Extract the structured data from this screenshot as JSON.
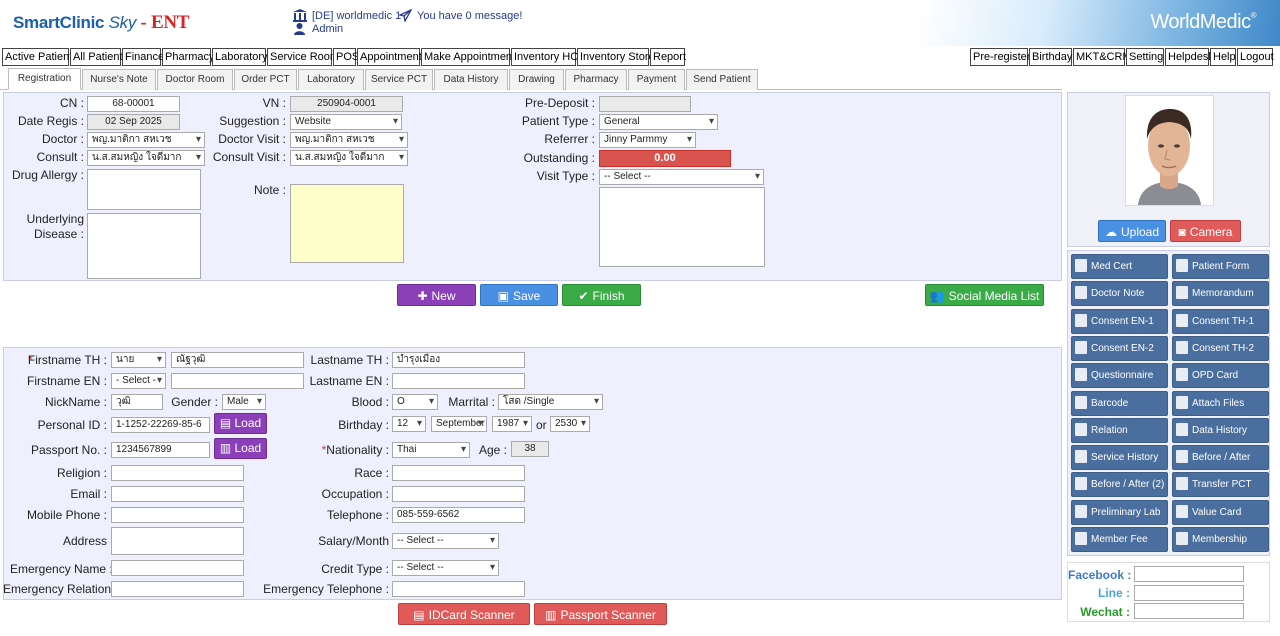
{
  "brand": {
    "name": "SmartClinic",
    "sky": "Sky",
    "dash": " - ",
    "ent": "ENT"
  },
  "header": {
    "branch": "[DE] worldmedic 1",
    "message": "You have 0 message!",
    "user": "Admin",
    "logo": "WorldMedic"
  },
  "menu_left": [
    "Active Patient",
    "All Patient",
    "Finance",
    "Pharmacy",
    "Laboratory",
    "Service Room",
    "POS",
    "Appointment",
    "Make Appointment",
    "Inventory HO",
    "Inventory Store",
    "Report"
  ],
  "menu_right": [
    "Pre-register",
    "Birthday",
    "MKT&CRM",
    "Setting",
    "Helpdesk",
    "Help",
    "Logout"
  ],
  "tabs": [
    "Registration",
    "Nurse's Note",
    "Doctor Room",
    "Order PCT",
    "Laboratory",
    "Service PCT",
    "Data History",
    "Drawing",
    "Pharmacy",
    "Payment",
    "Send Patient"
  ],
  "reg": {
    "cn_label": "CN :",
    "cn": "68-00001",
    "date_label": "Date Regis :",
    "date": "02 Sep 2025",
    "doctor_label": "Doctor :",
    "doctor": "พญ.มาติกา สหเวช",
    "consult_label": "Consult :",
    "consult": "น.ส.สมหญิง ใจดีมาก",
    "allergy_label": "Drug Allergy :",
    "underlying_label1": "Underlying",
    "underlying_label2": "Disease :",
    "vn_label": "VN :",
    "vn": "250904-0001",
    "suggestion_label": "Suggestion :",
    "suggestion": "Website",
    "dvisit_label": "Doctor Visit :",
    "dvisit": "พญ.มาติกา สหเวช",
    "cvisit_label": "Consult Visit :",
    "cvisit": "น.ส.สมหญิง ใจดีมาก",
    "note_label": "Note :",
    "predeposit_label": "Pre-Deposit :",
    "predeposit": "",
    "ptype_label": "Patient Type :",
    "ptype": "General",
    "referrer_label": "Referrer :",
    "referrer": "Jinny Parmmy",
    "outstanding_label": "Outstanding :",
    "outstanding": "0.00",
    "visittype_label": "Visit Type :",
    "visittype": "-- Select --"
  },
  "actions": {
    "new": "New",
    "save": "Save",
    "finish": "Finish",
    "social": "Social Media List"
  },
  "photo": {
    "upload": "Upload",
    "camera": "Camera"
  },
  "side_buttons": [
    [
      "Med Cert",
      "Patient Form"
    ],
    [
      "Doctor Note",
      "Memorandum"
    ],
    [
      "Consent EN-1",
      "Consent TH-1"
    ],
    [
      "Consent EN-2",
      "Consent TH-2"
    ],
    [
      "Questionnaire",
      "OPD Card"
    ],
    [
      "Barcode",
      "Attach Files"
    ],
    [
      "Relation",
      "Data History"
    ],
    [
      "Service History",
      "Before / After"
    ],
    [
      "Before / After (2)",
      "Transfer PCT"
    ],
    [
      "Preliminary Lab",
      "Value Card"
    ],
    [
      "Member Fee",
      "Membership"
    ]
  ],
  "social": {
    "facebook": "Facebook :",
    "line": "Line :",
    "wechat": "Wechat :",
    "colors": {
      "facebook": "#3b7ac9",
      "line": "#4aa3df",
      "wechat": "#2a9a2a"
    }
  },
  "patient": {
    "req": "*",
    "fname_th_label": "Firstname TH :",
    "prefix_th": "นาย",
    "fname_th": "ณัฐวุฒิ",
    "lname_th_label": "Lastname TH :",
    "lname_th": "บำรุงเมือง",
    "fname_en_label": "Firstname EN :",
    "prefix_en": "- Select -",
    "fname_en": "",
    "lname_en_label": "Lastname EN :",
    "lname_en": "",
    "nick_label": "NickName :",
    "nick": "วุฒิ",
    "gender_label": "Gender :",
    "gender": "Male",
    "blood_label": "Blood :",
    "blood": "O",
    "marital_label": "Marrital :",
    "marital": "โสด /Single",
    "pid_label": "Personal ID :",
    "pid": "1-1252-22269-85-6",
    "load": "Load",
    "bday_label": "Birthday :",
    "bday_d": "12",
    "bday_m": "September",
    "bday_y": "1987",
    "or": "or",
    "bday_be": "2530",
    "passport_label": "Passport No. :",
    "passport": "1234567899",
    "nat_label": "Nationality :",
    "nat": "Thai",
    "age_label": "Age :",
    "age": "38",
    "religion_label": "Religion :",
    "race_label": "Race :",
    "email_label": "Email :",
    "occupation_label": "Occupation :",
    "mobile_label": "Mobile Phone :",
    "tel_label": "Telephone :",
    "tel": "085-559-6562",
    "address_label": "Address",
    "salary_label": "Salary/Month",
    "salary": "-- Select --",
    "ename_label": "Emergency Name :",
    "credit_label": "Credit Type :",
    "credit": "-- Select --",
    "erel_label": "Emergency Relation :",
    "etel_label": "Emergency Telephone :"
  },
  "scanners": {
    "idcard": "IDCard Scanner",
    "passport": "Passport Scanner"
  }
}
